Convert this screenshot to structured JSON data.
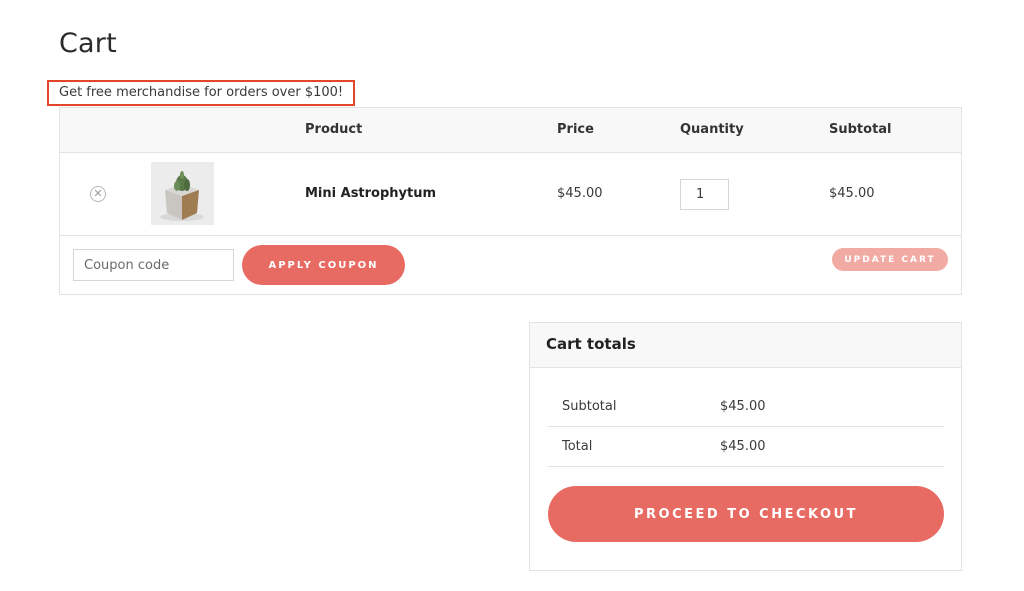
{
  "page": {
    "title": "Cart"
  },
  "notice": {
    "text": "Get free merchandise for orders over $100!"
  },
  "cart_table": {
    "headers": {
      "product": "Product",
      "price": "Price",
      "quantity": "Quantity",
      "subtotal": "Subtotal"
    },
    "items": [
      {
        "name": "Mini Astrophytum",
        "price": "$45.00",
        "quantity": "1",
        "subtotal": "$45.00",
        "thumbnail_icon": "cactus-pot-icon",
        "remove_icon": "remove-circle-icon"
      }
    ]
  },
  "coupon": {
    "placeholder": "Coupon code",
    "apply_label": "APPLY COUPON"
  },
  "update_cart_label": "UPDATE CART",
  "cart_totals": {
    "title": "Cart totals",
    "rows": [
      {
        "label": "Subtotal",
        "value": "$45.00"
      },
      {
        "label": "Total",
        "value": "$45.00"
      }
    ],
    "checkout_label": "PROCEED TO CHECKOUT"
  },
  "colors": {
    "accent": "#e86b63",
    "accent_disabled": "#f2aaa4",
    "notice_border": "#e2462d"
  }
}
